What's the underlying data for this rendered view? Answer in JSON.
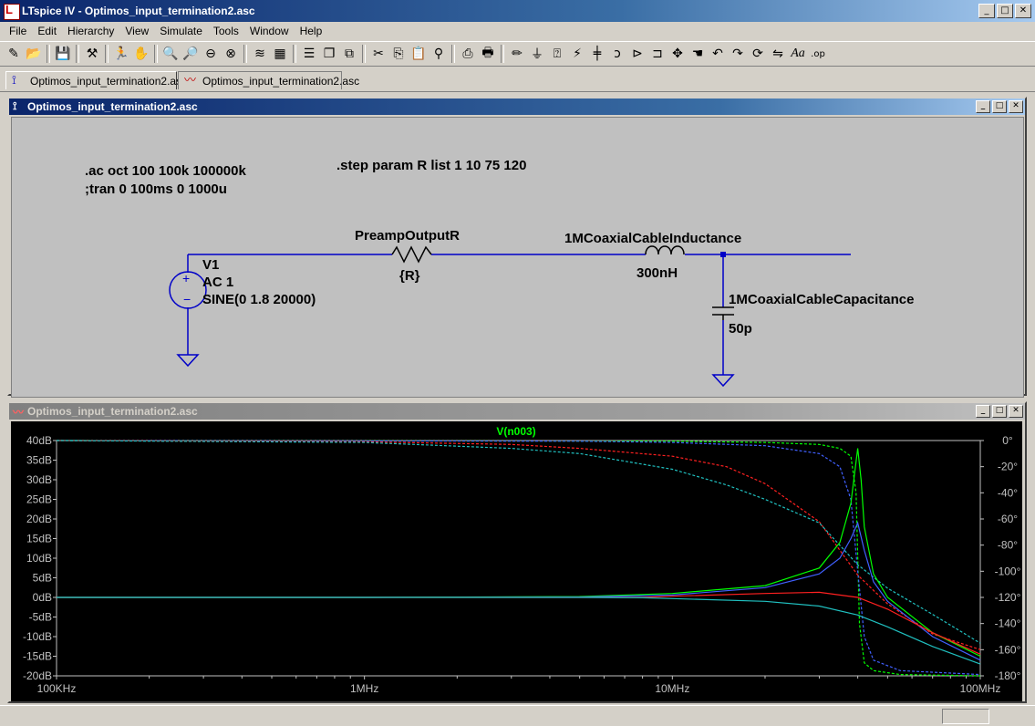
{
  "app": {
    "title": "LTspice IV - Optimos_input_termination2.asc",
    "icon": "ltspice-logo-icon"
  },
  "menu": [
    "File",
    "Edit",
    "Hierarchy",
    "View",
    "Simulate",
    "Tools",
    "Window",
    "Help"
  ],
  "toolbar": {
    "icons": [
      "new-schematic-icon",
      "open-icon",
      "save-icon",
      "control-panel-icon",
      "run-icon",
      "halt-icon",
      "zoom-in-icon",
      "zoom-out-icon",
      "zoom-fit-icon",
      "zoom-cancel-icon",
      "autorange-icon",
      "grid-icon",
      "tile-horizontal-icon",
      "cascade-icon",
      "close-all-icon",
      "cut-icon",
      "copy-icon",
      "paste-icon",
      "find-icon",
      "print-setup-icon",
      "print-icon",
      "wire-icon",
      "ground-icon",
      "label-net-icon",
      "resistor-icon",
      "capacitor-icon",
      "inductor-icon",
      "diode-icon",
      "component-icon",
      "move-icon",
      "drag-icon",
      "undo-icon",
      "redo-icon",
      "rotate-icon",
      "mirror-icon",
      "text-icon",
      "spice-directive-icon"
    ]
  },
  "tabs": [
    {
      "label": "Optimos_input_termination2.asc",
      "icon": "schematic-icon",
      "active": true
    },
    {
      "label": "Optimos_input_termination2.asc",
      "icon": "waveform-icon",
      "active": false
    }
  ],
  "schematic": {
    "title": "Optimos_input_termination2.asc",
    "directives": [
      ".ac oct 100 100k 100000k",
      ";tran 0 100ms 0 1000u",
      ".step param R list 1 10 75 120"
    ],
    "source": {
      "name": "V1",
      "value1": "AC 1",
      "value2": "SINE(0 1.8 20000)"
    },
    "resistor": {
      "name": "PreampOutputR",
      "value": "{R}"
    },
    "inductor": {
      "name": "1MCoaxialCableInductance",
      "value": "300nH"
    },
    "capacitor": {
      "name": "1MCoaxialCableCapacitance",
      "value": "50p"
    }
  },
  "waveform": {
    "title": "Optimos_input_termination2.asc",
    "trace_label": "V(n003)",
    "trace_label_color": "#00ff00"
  },
  "chart_data": {
    "type": "line",
    "title": "V(n003)",
    "xscale": "log",
    "xlim": [
      100000,
      100000000
    ],
    "x_ticks": [
      "100KHz",
      "1MHz",
      "10MHz",
      "100MHz"
    ],
    "y_left_ticks": [
      "40dB",
      "35dB",
      "30dB",
      "25dB",
      "20dB",
      "15dB",
      "10dB",
      "5dB",
      "0dB",
      "-5dB",
      "-10dB",
      "-15dB",
      "-20dB"
    ],
    "y_left_lim": [
      -20,
      40
    ],
    "y_right_ticks": [
      "0°",
      "-20°",
      "-40°",
      "-60°",
      "-80°",
      "-100°",
      "-120°",
      "-140°",
      "-160°",
      "-180°"
    ],
    "y_right_lim": [
      -180,
      0
    ],
    "magnitude_series": [
      {
        "step": "R=1",
        "color": "#00ff00",
        "x": [
          100000,
          1000000,
          5000000,
          10000000,
          20000000,
          30000000,
          35000000,
          38000000,
          40000000,
          41000000,
          42000000,
          45000000,
          50000000,
          70000000,
          100000000
        ],
        "y": [
          0,
          0,
          0.2,
          1,
          3,
          7.5,
          14,
          24,
          38,
          30,
          18,
          6,
          0,
          -9,
          -15
        ]
      },
      {
        "step": "R=10",
        "color": "#4060ff",
        "x": [
          100000,
          1000000,
          5000000,
          10000000,
          20000000,
          30000000,
          35000000,
          38000000,
          40000000,
          42000000,
          45000000,
          50000000,
          70000000,
          100000000
        ],
        "y": [
          0,
          0,
          0.1,
          0.6,
          2.5,
          6,
          10,
          15,
          19,
          12,
          4,
          -1,
          -10,
          -16
        ]
      },
      {
        "step": "R=75",
        "color": "#ff2020",
        "x": [
          100000,
          1000000,
          5000000,
          8000000,
          10000000,
          20000000,
          30000000,
          40000000,
          50000000,
          70000000,
          100000000
        ],
        "y": [
          0,
          0,
          0,
          0,
          0.3,
          1,
          1.3,
          0,
          -3,
          -9,
          -14.5
        ]
      },
      {
        "step": "R=120",
        "color": "#20c0c0",
        "x": [
          100000,
          1000000,
          5000000,
          8000000,
          10000000,
          20000000,
          30000000,
          40000000,
          50000000,
          70000000,
          100000000
        ],
        "y": [
          0,
          0,
          0,
          -0.1,
          -0.3,
          -1,
          -2.2,
          -4.5,
          -7.5,
          -12.5,
          -17
        ]
      }
    ],
    "phase_series": [
      {
        "step": "R=1",
        "color": "#00ff00",
        "x": [
          100000,
          10000000,
          20000000,
          30000000,
          35000000,
          38000000,
          39500000,
          40500000,
          42000000,
          45000000,
          55000000,
          100000000
        ],
        "y": [
          0,
          -0.5,
          -1.5,
          -3,
          -6,
          -12,
          -40,
          -140,
          -170,
          -176,
          -179,
          -180
        ]
      },
      {
        "step": "R=10",
        "color": "#4060ff",
        "x": [
          100000,
          5000000,
          10000000,
          20000000,
          30000000,
          35000000,
          38000000,
          40000000,
          42000000,
          45000000,
          55000000,
          100000000
        ],
        "y": [
          0,
          -0.5,
          -1.5,
          -4,
          -10,
          -20,
          -45,
          -100,
          -150,
          -168,
          -176,
          -179
        ]
      },
      {
        "step": "R=75",
        "color": "#ff2020",
        "x": [
          100000,
          1000000,
          3000000,
          5000000,
          10000000,
          15000000,
          20000000,
          30000000,
          40000000,
          50000000,
          70000000,
          100000000
        ],
        "y": [
          0,
          -1,
          -3,
          -6,
          -12,
          -20,
          -33,
          -62,
          -103,
          -125,
          -148,
          -160
        ]
      },
      {
        "step": "R=120",
        "color": "#20c0c0",
        "x": [
          100000,
          1000000,
          3000000,
          5000000,
          10000000,
          15000000,
          20000000,
          30000000,
          40000000,
          50000000,
          70000000,
          100000000
        ],
        "y": [
          0,
          -1.5,
          -6,
          -10,
          -22,
          -34,
          -45,
          -63,
          -95,
          -113,
          -133,
          -155
        ]
      }
    ]
  }
}
